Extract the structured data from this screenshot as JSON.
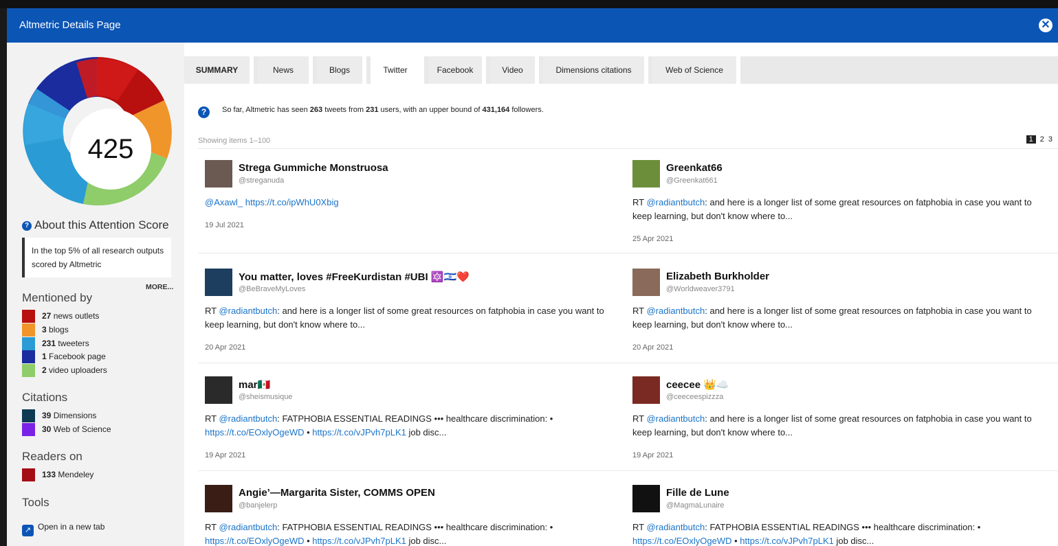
{
  "titlebar": {
    "title": "Altmetric Details Page",
    "close_glyph": "✕"
  },
  "score": {
    "value": "425"
  },
  "about": {
    "label": "About this Attention Score",
    "top_text": "In the top 5% of all research outputs scored by Altmetric",
    "more": "MORE..."
  },
  "mentioned": {
    "heading": "Mentioned by",
    "items": [
      {
        "count": "27",
        "label": "news outlets",
        "color": "#b80f0f"
      },
      {
        "count": "3",
        "label": "blogs",
        "color": "#f0952a"
      },
      {
        "count": "231",
        "label": "tweeters",
        "color": "#2a9bd4"
      },
      {
        "count": "1",
        "label": "Facebook page",
        "color": "#1a2c9e"
      },
      {
        "count": "2",
        "label": "video uploaders",
        "color": "#8fcc6a"
      }
    ]
  },
  "citations": {
    "heading": "Citations",
    "items": [
      {
        "count": "39",
        "label": "Dimensions",
        "color": "#0e3a54"
      },
      {
        "count": "30",
        "label": "Web of Science",
        "color": "#7a22e6"
      }
    ]
  },
  "readers": {
    "heading": "Readers on",
    "items": [
      {
        "count": "133",
        "label": "Mendeley",
        "color": "#a40d14"
      }
    ]
  },
  "tools": {
    "heading": "Tools",
    "open_new_tab": "Open in a new tab",
    "icon": "external-link-icon"
  },
  "tabs": [
    {
      "label": "SUMMARY"
    },
    {
      "label": "News"
    },
    {
      "label": "Blogs"
    },
    {
      "label": "Twitter"
    },
    {
      "label": "Facebook"
    },
    {
      "label": "Video"
    },
    {
      "label": "Dimensions citations"
    },
    {
      "label": "Web of Science"
    }
  ],
  "info": {
    "prefix": "So far, Altmetric has seen ",
    "tweets": "263",
    "mid1": " tweets from ",
    "users": "231",
    "mid2": " users, with an upper bound of ",
    "followers": "431,164",
    "suffix": " followers."
  },
  "showing": "Showing items 1–100",
  "pages": [
    "1",
    "2",
    "3"
  ],
  "tweets": [
    {
      "name": "Strega Gummiche Monstruosa",
      "handle": "@streganuda",
      "body": [
        {
          "link": "@Axawl_"
        },
        {
          "text": " "
        },
        {
          "link": "https://t.co/ipWhU0Xbig"
        }
      ],
      "date": "19 Jul 2021",
      "avatar_color": "#6b5a52"
    },
    {
      "name": "Greenkat66",
      "handle": "@Greenkat661",
      "body": [
        {
          "text": "RT "
        },
        {
          "link": "@radiantbutch"
        },
        {
          "text": ": and here is a longer list of some great resources on fatphobia in case you want to keep learning, but don't know where to..."
        }
      ],
      "date": "25 Apr 2021",
      "avatar_color": "#6c8e3a"
    },
    {
      "name": "You matter, loves #FreeKurdistan #UBI 🔯🇮🇱❤️",
      "handle": "@BeBraveMyLoves",
      "body": [
        {
          "text": "RT "
        },
        {
          "link": "@radiantbutch"
        },
        {
          "text": ": and here is a longer list of some great resources on fatphobia in case you want to keep learning, but don't know where to..."
        }
      ],
      "date": "20 Apr 2021",
      "avatar_color": "#1d3e5e"
    },
    {
      "name": "Elizabeth Burkholder",
      "handle": "@Worldweaver3791",
      "body": [
        {
          "text": "RT "
        },
        {
          "link": "@radiantbutch"
        },
        {
          "text": ": and here is a longer list of some great resources on fatphobia in case you want to keep learning, but don't know where to..."
        }
      ],
      "date": "20 Apr 2021",
      "avatar_color": "#8a6a5a"
    },
    {
      "name": "mar🇲🇽",
      "handle": "@sheismusique",
      "body": [
        {
          "text": "RT "
        },
        {
          "link": "@radiantbutch"
        },
        {
          "text": ": FATPHOBIA ESSENTIAL READINGS ••• healthcare discrimination: • "
        },
        {
          "link": "https://t.co/EOxlyOgeWD"
        },
        {
          "text": " • "
        },
        {
          "link": "https://t.co/vJPvh7pLK1"
        },
        {
          "text": " job disc..."
        }
      ],
      "date": "19 Apr 2021",
      "avatar_color": "#2a2a2a"
    },
    {
      "name": "ceecee 👑☁️",
      "handle": "@ceeceespizzza",
      "body": [
        {
          "text": "RT "
        },
        {
          "link": "@radiantbutch"
        },
        {
          "text": ": and here is a longer list of some great resources on fatphobia in case you want to keep learning, but don't know where to..."
        }
      ],
      "date": "19 Apr 2021",
      "avatar_color": "#7a2a22"
    },
    {
      "name": "Angie’—Margarita Sister, COMMS OPEN",
      "handle": "@banjelerp",
      "body": [
        {
          "text": "RT "
        },
        {
          "link": "@radiantbutch"
        },
        {
          "text": ": FATPHOBIA ESSENTIAL READINGS ••• healthcare discrimination: • "
        },
        {
          "link": "https://t.co/EOxlyOgeWD"
        },
        {
          "text": " • "
        },
        {
          "link": "https://t.co/vJPvh7pLK1"
        },
        {
          "text": " job disc..."
        }
      ],
      "date": "",
      "avatar_color": "#3a1e16"
    },
    {
      "name": "Fille de Lune",
      "handle": "@MagmaLunaire",
      "body": [
        {
          "text": "RT "
        },
        {
          "link": "@radiantbutch"
        },
        {
          "text": ": FATPHOBIA ESSENTIAL READINGS ••• healthcare discrimination: • "
        },
        {
          "link": "https://t.co/EOxlyOgeWD"
        },
        {
          "text": " • "
        },
        {
          "link": "https://t.co/vJPvh7pLK1"
        },
        {
          "text": " job disc..."
        }
      ],
      "date": "",
      "avatar_color": "#111111"
    }
  ]
}
